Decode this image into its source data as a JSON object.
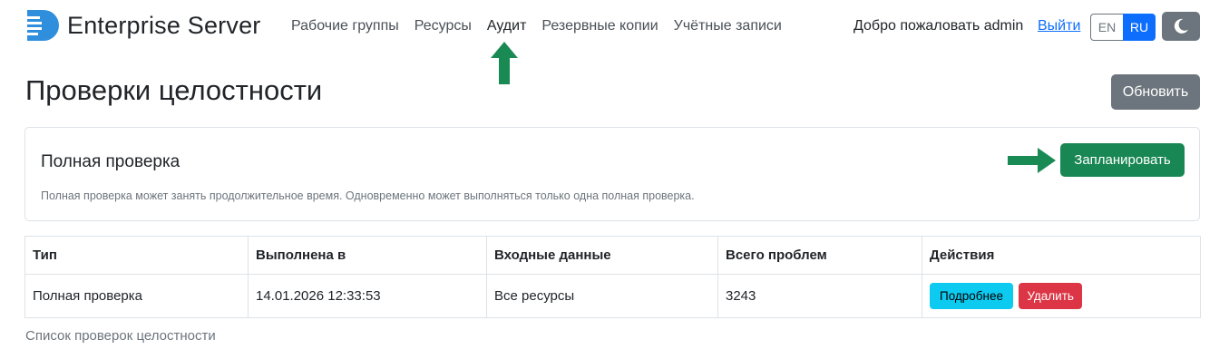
{
  "header": {
    "app_title": "Enterprise Server",
    "nav": [
      {
        "label": "Рабочие группы"
      },
      {
        "label": "Ресурсы"
      },
      {
        "label": "Аудит"
      },
      {
        "label": "Резервные копии"
      },
      {
        "label": "Учётные записи"
      }
    ],
    "active_nav": "Аудит",
    "welcome": "Добро пожаловать admin",
    "logout": "Выйти",
    "languages": [
      "EN",
      "RU"
    ],
    "active_language": "RU",
    "theme_toggle_icon": "moon-icon"
  },
  "page": {
    "title": "Проверки целостности",
    "refresh_label": "Обновить"
  },
  "card": {
    "title": "Полная проверка",
    "text": "Полная проверка может занять продолжительное время. Одновременно может выполняться только одна полная проверка.",
    "schedule_label": "Запланировать"
  },
  "table": {
    "headers": [
      "Тип",
      "Выполнена в",
      "Входные данные",
      "Всего проблем",
      "Действия"
    ],
    "rows": [
      {
        "type": "Полная проверка",
        "executed_at": "14.01.2026 12:33:53",
        "input": "Все ресурсы",
        "total_problems": "3243",
        "details_label": "Подробнее",
        "delete_label": "Удалить"
      }
    ],
    "caption": "Список проверок целостности"
  },
  "colors": {
    "primary": "#0d6efd",
    "success": "#198754",
    "secondary": "#6c757d",
    "info": "#0dcaf0",
    "danger": "#dc3545",
    "annotation_arrow": "#1a8a55"
  }
}
